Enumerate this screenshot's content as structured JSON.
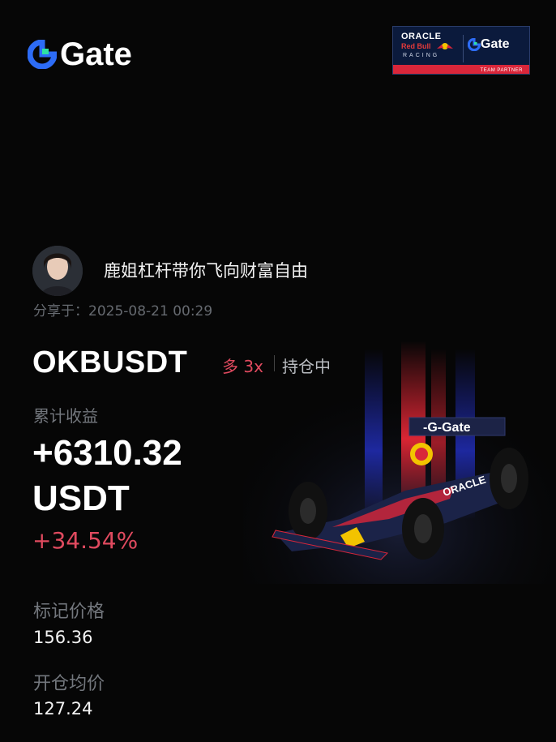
{
  "brand": {
    "name": "Gate"
  },
  "partner_badge": {
    "line1": "ORACLE",
    "line2": "Red Bull",
    "line3": "RACING",
    "partner_name": "Gate",
    "footer": "TEAM PARTNER"
  },
  "user": {
    "name": "鹿姐杠杆带你飞向财富自由",
    "share_label": "分享于：",
    "share_time": "2025-08-21 00:29"
  },
  "position": {
    "symbol": "OKBUSDT",
    "side": "多 3x",
    "status": "持仓中",
    "pnl_label": "累计收益",
    "pnl_value": "+6310.32",
    "pnl_unit": "USDT",
    "pnl_percent": "+34.54%",
    "mark_price_label": "标记价格",
    "mark_price": "156.36",
    "entry_price_label": "开仓均价",
    "entry_price": "127.24"
  },
  "colors": {
    "background": "#060606",
    "brand_blue": "#2d6cf6",
    "brand_green": "#2ee2a3",
    "long_red": "#e04a5f",
    "muted_text": "#73777d"
  }
}
